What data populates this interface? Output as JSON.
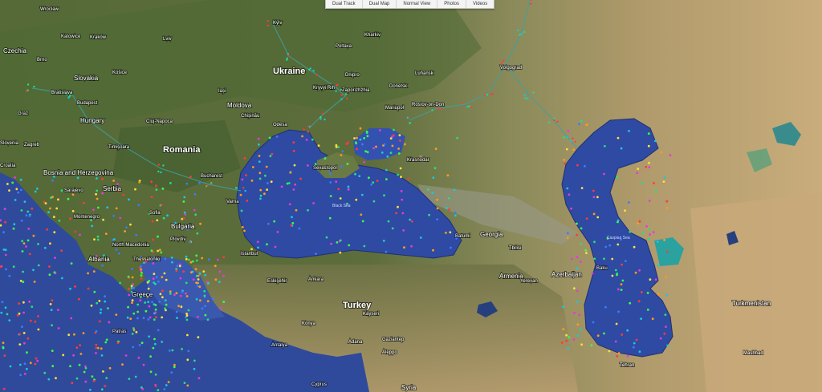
{
  "tabs": [
    "Dual Track",
    "Dual Map",
    "Normal View",
    "Photos",
    "Videos"
  ],
  "countries": [
    {
      "id": "czechia",
      "label": "Czechia"
    },
    {
      "id": "slovakia",
      "label": "Slovakia"
    },
    {
      "id": "ukraine",
      "label": "Ukraine"
    },
    {
      "id": "moldova",
      "label": "Moldova"
    },
    {
      "id": "hungary",
      "label": "Hungary"
    },
    {
      "id": "romania",
      "label": "Romania"
    },
    {
      "id": "bosnia",
      "label": "Bosnia and Herzegovina"
    },
    {
      "id": "serbia",
      "label": "Serbia"
    },
    {
      "id": "bulgaria",
      "label": "Bulgaria"
    },
    {
      "id": "montenegro",
      "label": "Montenegro"
    },
    {
      "id": "north-macedonia",
      "label": "North Macedonia"
    },
    {
      "id": "albania",
      "label": "Albania"
    },
    {
      "id": "greece",
      "label": "Greece"
    },
    {
      "id": "turkey",
      "label": "Turkey"
    },
    {
      "id": "georgia",
      "label": "Georgia"
    },
    {
      "id": "armenia",
      "label": "Armenia"
    },
    {
      "id": "azerbaijan",
      "label": "Azerbaijan"
    },
    {
      "id": "turkmenistan",
      "label": "Turkmenistan"
    },
    {
      "id": "syria",
      "label": "Syria"
    },
    {
      "id": "croatia",
      "label": "Croatia"
    },
    {
      "id": "slovenia",
      "label": "Slovenia"
    }
  ],
  "cities": [
    {
      "id": "wroclaw",
      "label": "Wrocław"
    },
    {
      "id": "katowice",
      "label": "Katowice"
    },
    {
      "id": "krakow",
      "label": "Kraków"
    },
    {
      "id": "lviv",
      "label": "Lviv"
    },
    {
      "id": "kyiv",
      "label": "Kyiv"
    },
    {
      "id": "kharkiv",
      "label": "Kharkiv"
    },
    {
      "id": "poltava",
      "label": "Poltava"
    },
    {
      "id": "brno",
      "label": "Brno"
    },
    {
      "id": "kosice",
      "label": "Košice"
    },
    {
      "id": "bratislava",
      "label": "Bratislava"
    },
    {
      "id": "budapest",
      "label": "Budapest"
    },
    {
      "id": "graz",
      "label": "Graz"
    },
    {
      "id": "cluj",
      "label": "Cluj-Napoca"
    },
    {
      "id": "iasi",
      "label": "Iași"
    },
    {
      "id": "chisinau",
      "label": "Chișinău"
    },
    {
      "id": "odesa",
      "label": "Odesa"
    },
    {
      "id": "dnipro",
      "label": "Dnipro"
    },
    {
      "id": "zaporizhzhia",
      "label": "Zaporizhzhia"
    },
    {
      "id": "kryvyi-rih",
      "label": "Kryvyi Rih"
    },
    {
      "id": "donetsk",
      "label": "Donetsk"
    },
    {
      "id": "luhansk",
      "label": "Luhansk"
    },
    {
      "id": "mariupol",
      "label": "Mariupol"
    },
    {
      "id": "rostov",
      "label": "Rostov-on-Don"
    },
    {
      "id": "volgograd",
      "label": "Volgograd"
    },
    {
      "id": "krasnodar",
      "label": "Krasnodar"
    },
    {
      "id": "sevastopol",
      "label": "Sevastopol"
    },
    {
      "id": "zagreb",
      "label": "Zagreb"
    },
    {
      "id": "timisoara",
      "label": "Timișoara"
    },
    {
      "id": "sarajevo",
      "label": "Sarajevo"
    },
    {
      "id": "bucharest",
      "label": "Bucharest"
    },
    {
      "id": "varna",
      "label": "Varna"
    },
    {
      "id": "sofia",
      "label": "Sofia"
    },
    {
      "id": "plovdiv",
      "label": "Plovdiv"
    },
    {
      "id": "thessaloniki",
      "label": "Thessaloniki"
    },
    {
      "id": "istanbul",
      "label": "Istanbul"
    },
    {
      "id": "eskisehir",
      "label": "Eskişehir"
    },
    {
      "id": "ankara",
      "label": "Ankara"
    },
    {
      "id": "konya",
      "label": "Konya"
    },
    {
      "id": "kayseri",
      "label": "Kayseri"
    },
    {
      "id": "antalya",
      "label": "Antalya"
    },
    {
      "id": "adana",
      "label": "Adana"
    },
    {
      "id": "gaziantep",
      "label": "Gaziantep"
    },
    {
      "id": "aleppo",
      "label": "Aleppo"
    },
    {
      "id": "tbilisi",
      "label": "Tbilisi"
    },
    {
      "id": "yerevan",
      "label": "Yerevan"
    },
    {
      "id": "baku",
      "label": "Baku"
    },
    {
      "id": "tehran",
      "label": "Tehran"
    },
    {
      "id": "mashhad",
      "label": "Mashhad"
    },
    {
      "id": "batumi",
      "label": "Batumi"
    },
    {
      "id": "cyprus",
      "label": "Cyprus"
    },
    {
      "id": "patras",
      "label": "Patras"
    }
  ],
  "seas": [
    {
      "id": "black-sea",
      "label": "Black Sea"
    },
    {
      "id": "caspian-sea",
      "label": "Caspian Sea"
    }
  ]
}
